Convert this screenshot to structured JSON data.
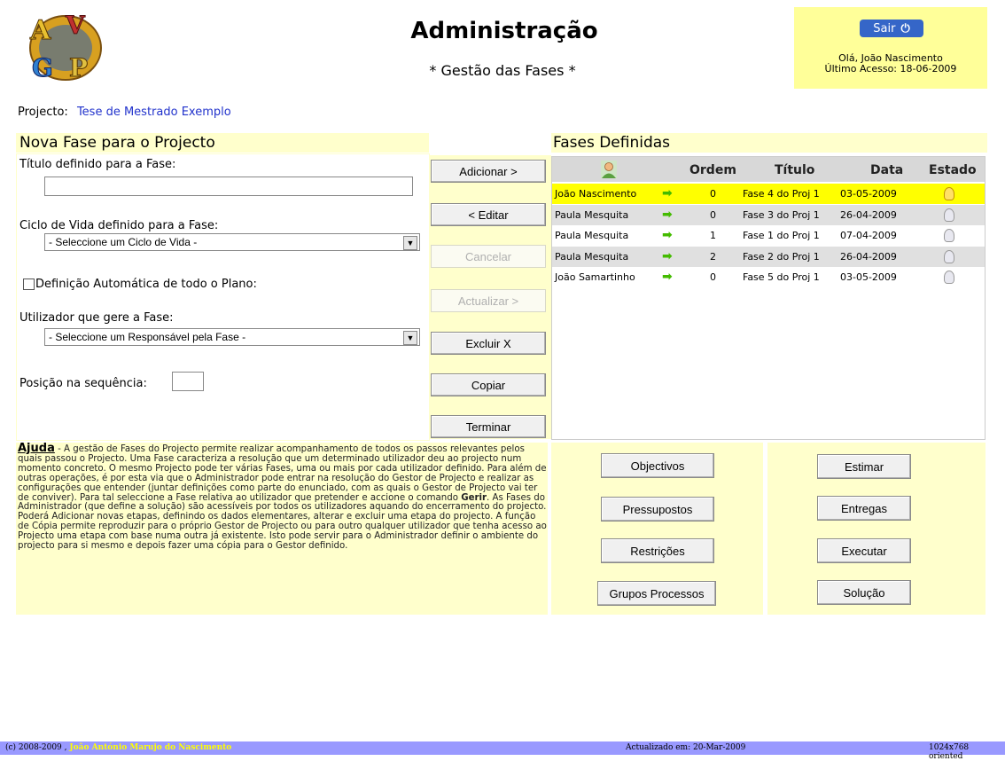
{
  "header": {
    "title": "Administração",
    "subtitle": "* Gestão das Fases *",
    "logo_text": "AVGP"
  },
  "user": {
    "logout_label": "Sair",
    "greeting": "Olá, João Nascimento",
    "last_access": "Último Acesso: 18-06-2009"
  },
  "project": {
    "label": "Projecto:",
    "name": "Tese de Mestrado Exemplo"
  },
  "form": {
    "section_title": "Nova Fase para o Projecto",
    "title_label": "Título definido para a Fase:",
    "title_value": "",
    "lifecycle_label": "Ciclo de Vida definido para a Fase:",
    "lifecycle_selected": "- Seleccione um Ciclo de Vida -",
    "auto_label": "Definição Automática de todo o Plano:",
    "auto_checked": false,
    "manager_label": "Utilizador que gere a Fase:",
    "manager_selected": "- Seleccione um Responsável pela Fase -",
    "position_label": "Posição na sequência:",
    "position_value": ""
  },
  "actions": {
    "add": "Adicionar >",
    "edit": "< Editar",
    "cancel": "Cancelar",
    "update": "Actualizar >",
    "delete": "Excluir X",
    "copy": "Copiar",
    "finish": "Terminar"
  },
  "phases": {
    "section_title": "Fases Definidas",
    "columns": [
      "Ordem",
      "Título",
      "Data",
      "Estado"
    ],
    "rows": [
      {
        "user": "João Nascimento",
        "order": "0",
        "title": "Fase 4 do Proj 1",
        "date": "03-05-2009",
        "highlight": true
      },
      {
        "user": "Paula Mesquita",
        "order": "0",
        "title": "Fase 3 do Proj 1",
        "date": "26-04-2009"
      },
      {
        "user": "Paula Mesquita",
        "order": "1",
        "title": "Fase 1 do Proj 1",
        "date": "07-04-2009"
      },
      {
        "user": "Paula Mesquita",
        "order": "2",
        "title": "Fase 2 do Proj 1",
        "date": "26-04-2009"
      },
      {
        "user": "João Samartinho",
        "order": "0",
        "title": "Fase 5 do Proj 1",
        "date": "03-05-2009"
      }
    ],
    "row_colors": {
      "highlight": "#ffff00",
      "alt": "#e0e0e0",
      "normal": "#ffffff"
    }
  },
  "help": {
    "keyword": "Ajuda",
    "text_1": " - A gestão de Fases do Projecto permite realizar acompanhamento de todos os passos relevantes pelos quais passou o Projecto. Uma Fase caracteriza a resolução que um determinado utilizador deu ao projecto num momento concreto. O mesmo Projecto pode ter várias Fases, uma ou mais por cada utilizador definido. Para além de outras operações, é por esta via que o Administrador pode entrar na resolução do Gestor de Projecto e realizar as configurações que entender (juntar definições como parte do enunciado, com as quais o Gestor de Projecto vai ter de conviver). Para tal seleccione a Fase relativa ao utilizador que pretender e accione o comando ",
    "text_bold": "Gerir",
    "text_2": ". As Fases do Administrador (que define a solução) são acessíveis por todos os utilizadores aquando do encerramento do projecto. Poderá Adicionar novas etapas, definindo os dados elementares, alterar e excluir uma etapa do projecto. A função de Cópia permite reproduzir para o próprio Gestor de Projecto ou para outro qualquer utilizador que tenha acesso ao Projecto uma etapa com base numa outra já existente. Isto pode servir para o Administrador definir o ambiente do projecto para si mesmo e depois fazer uma cópia para o Gestor definido."
  },
  "nav": {
    "objectives": "Objectivos",
    "assumptions": "Pressupostos",
    "restrictions": "Restrições",
    "process_groups": "Grupos Processos",
    "estimate": "Estimar",
    "deliveries": "Entregas",
    "execute": "Executar",
    "solution": "Solução"
  },
  "footer": {
    "copyright": "(c) 2008-2009 ,",
    "author": "João António Marujo do Nascimento",
    "updated": "Actualizado em: 20-Mar-2009",
    "resolution": "1024x768 oriented"
  }
}
